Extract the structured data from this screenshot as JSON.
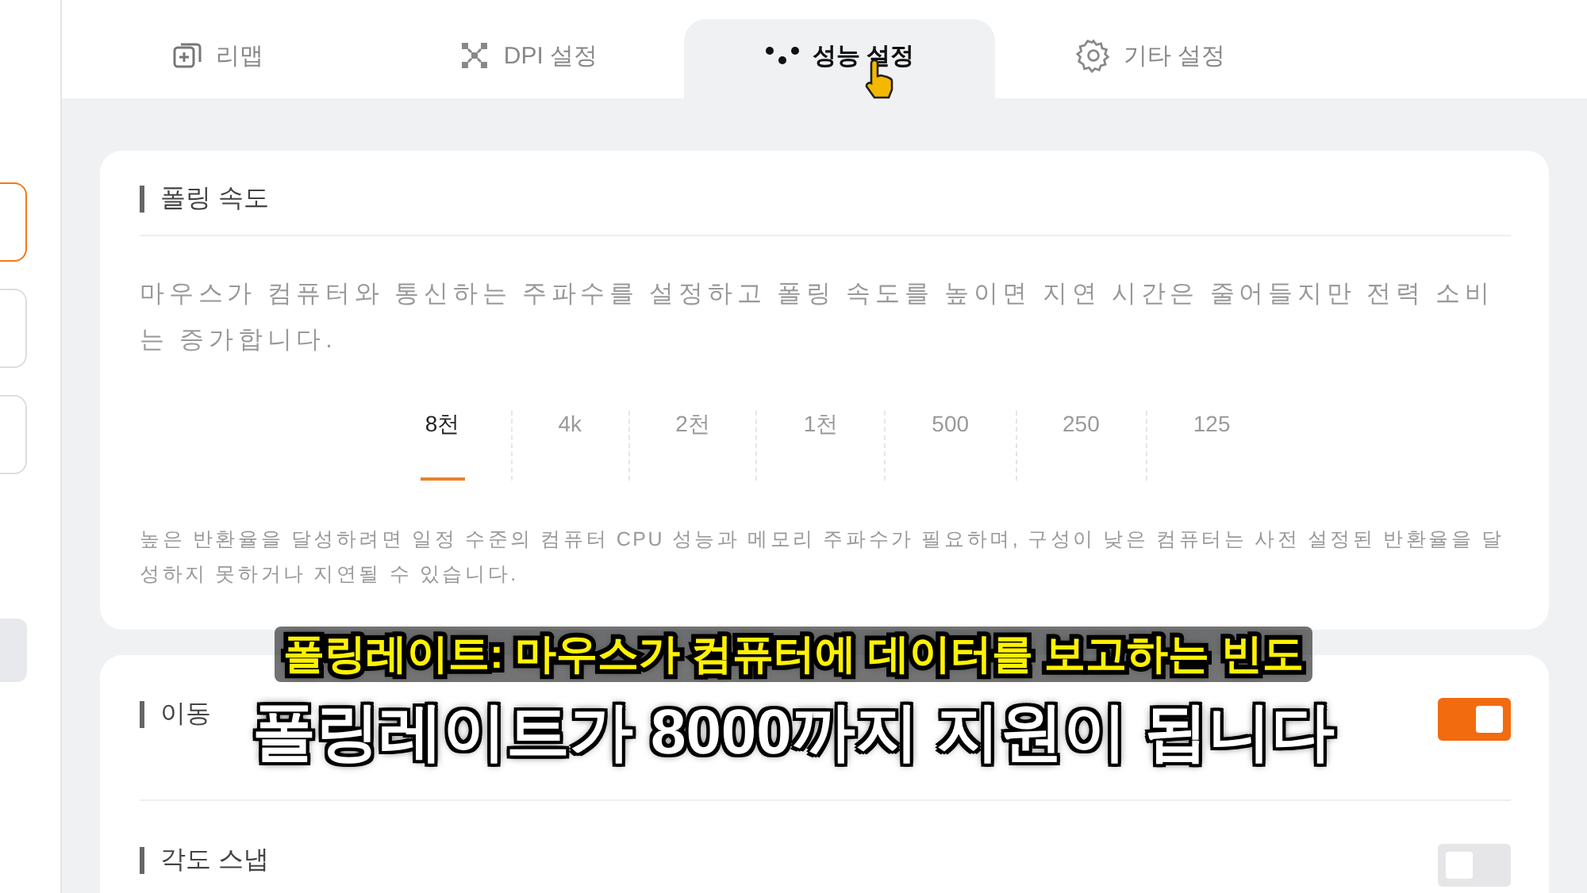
{
  "sidebar": {
    "items": [
      {
        "selected": true
      },
      {
        "selected": false
      },
      {
        "selected": false
      }
    ]
  },
  "tabs": [
    {
      "label": "리맵",
      "kind": "remap",
      "selected": false
    },
    {
      "label": "DPI 설정",
      "kind": "dpi",
      "selected": false
    },
    {
      "label": "성능 설정",
      "kind": "performance",
      "selected": true
    },
    {
      "label": "기타 설정",
      "kind": "other",
      "selected": false
    }
  ],
  "polling": {
    "title": "폴링 속도",
    "description": "마우스가 컴퓨터와 통신하는 주파수를 설정하고 폴링 속도를 높이면 지연 시간은 줄어들지만 전력 소비는 증가합니다.",
    "options": [
      {
        "label": "8천",
        "selected": true
      },
      {
        "label": "4k",
        "selected": false
      },
      {
        "label": "2천",
        "selected": false
      },
      {
        "label": "1천",
        "selected": false
      },
      {
        "label": "500",
        "selected": false
      },
      {
        "label": "250",
        "selected": false
      },
      {
        "label": "125",
        "selected": false
      }
    ],
    "note": "높은 반환율을 달성하려면 일정 수준의 컴퓨터 CPU 성능과 메모리 주파수가 필요하며, 구성이 낮은 컴퓨터는 사전 설정된 반환율을 달성하지 못하거나 지연될 수 있습니다."
  },
  "settings": [
    {
      "title": "이동",
      "on": true
    },
    {
      "title": "각도 스냅",
      "on": false
    }
  ],
  "subtitles": [
    {
      "text": "폴링레이트: 마우스가 컴퓨터에 데이터를 보고하는 빈도",
      "kind": "highlight"
    },
    {
      "text": "폴링레이트가 8000까지 지원이 됩니다",
      "kind": "main"
    }
  ]
}
